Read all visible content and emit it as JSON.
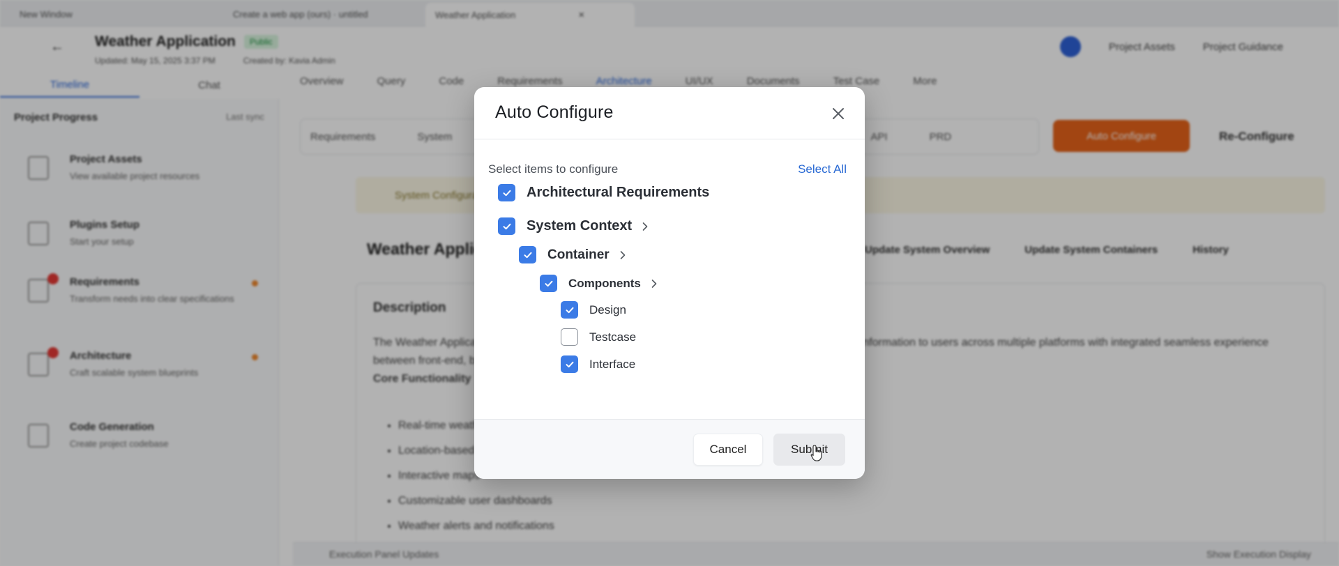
{
  "background": {
    "browser_tabs": [
      "New Window",
      "Create a web app (ours) · untitled",
      "Weather Application"
    ],
    "app_title": "Weather Application",
    "status_badge": "Public",
    "updated_meta": "Updated: May 15, 2025 3:37 PM",
    "created_meta": "Created by: Kavia Admin",
    "header_actions": [
      "Project Assets",
      "Project Guidance"
    ],
    "left_tabs": [
      "Timeline",
      "Chat"
    ],
    "sidebar_title": "Project Progress",
    "sidebar_action": "Last sync",
    "steps": [
      {
        "title": "Project Assets",
        "desc": "View available project resources"
      },
      {
        "title": "Plugins Setup",
        "desc": "Start your setup"
      },
      {
        "title": "Requirements",
        "desc": "Transform needs into clear specifications"
      },
      {
        "title": "Architecture",
        "desc": "Craft scalable system blueprints"
      },
      {
        "title": "Code Generation",
        "desc": "Create project codebase"
      }
    ],
    "main_tabs": [
      "Overview",
      "Query",
      "Code",
      "Requirements",
      "Architecture",
      "UI/UX",
      "Documents",
      "Test Case",
      "More"
    ],
    "sub_tabs": [
      "Requirements",
      "System",
      "API",
      "PRD"
    ],
    "auto_configure_btn": "Auto Configure",
    "re_configure_btn": "Re-Configure",
    "notice_text": "System Configuration",
    "section_title": "Weather Application",
    "section_actions": [
      "Update System Overview",
      "Update System Containers",
      "History"
    ],
    "desc_title": "Description",
    "desc_text": "The Weather Application provides real-time weather updates, forecasts, and personalized weather information to users across multiple platforms with integrated seamless experience between front-end, back-end, and data processing services.",
    "key_functionality": "Core Functionality",
    "bullets": [
      "Real-time weather data",
      "Location-based forecasts",
      "Interactive maps",
      "Customizable user dashboards",
      "Weather alerts and notifications"
    ],
    "bottom_bar": "Execution Panel Updates",
    "bottom_right": "Show Execution Display"
  },
  "modal": {
    "title": "Auto Configure",
    "instruction": "Select items to configure",
    "select_all": "Select All",
    "items": [
      {
        "label": "Architectural Requirements",
        "checked": true,
        "level": 0,
        "expandable": false
      },
      {
        "label": "System Context",
        "checked": true,
        "level": 0,
        "expandable": true
      },
      {
        "label": "Container",
        "checked": true,
        "level": 1,
        "expandable": true
      },
      {
        "label": "Components",
        "checked": true,
        "level": 2,
        "expandable": true
      },
      {
        "label": "Design",
        "checked": true,
        "level": 3,
        "expandable": false
      },
      {
        "label": "Testcase",
        "checked": false,
        "level": 3,
        "expandable": false
      },
      {
        "label": "Interface",
        "checked": true,
        "level": 3,
        "expandable": false
      }
    ],
    "cancel_label": "Cancel",
    "submit_label": "Submit"
  },
  "colors": {
    "accent": "#3b7be6",
    "link": "#2a6ad4",
    "orange": "#e8641a",
    "overlay": "rgba(0,0,0,0.30)"
  },
  "icons": [
    "close-icon",
    "check-icon",
    "chevron-right-icon",
    "pointer-cursor-icon"
  ]
}
